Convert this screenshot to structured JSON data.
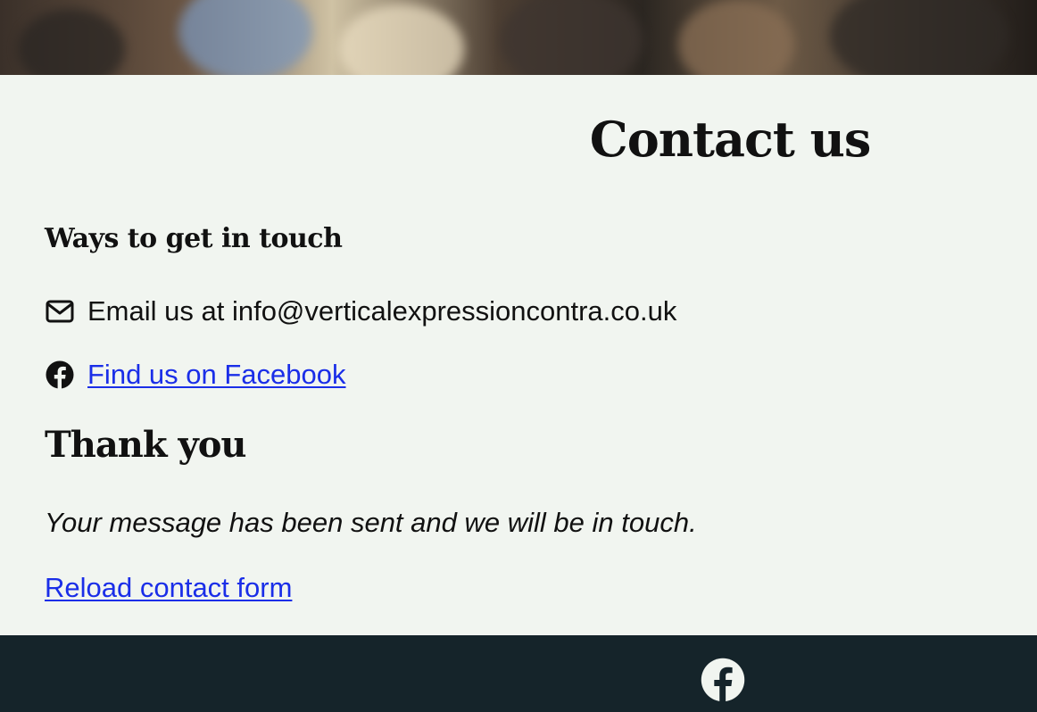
{
  "hero": {
    "image_icon": "crowd-dancing-photo"
  },
  "page": {
    "title": "Contact us"
  },
  "ways": {
    "heading": "Ways to get in touch",
    "email_icon": "envelope-icon",
    "email_text": "Email us at info@verticalexpressioncontra.co.uk",
    "facebook_icon": "facebook-icon",
    "facebook_link": "Find us on Facebook"
  },
  "confirmation": {
    "heading": "Thank you",
    "message": "Your message has been sent and we will be in touch.",
    "reload_link": "Reload contact form"
  },
  "footer": {
    "facebook_icon": "facebook-icon"
  },
  "colors": {
    "page_background": "#f1f5f0",
    "footer_background": "#15242a",
    "link": "#1a2ee8",
    "text": "#111111"
  }
}
